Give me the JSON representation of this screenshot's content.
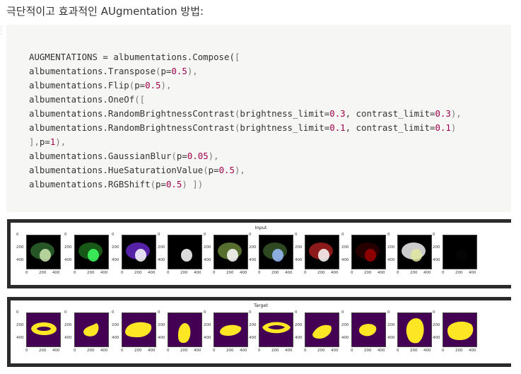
{
  "heading": "극단적이고 효과적인 AUgmentation 방법:",
  "code": {
    "lines": [
      [
        {
          "t": "AUGMENTATIONS = albumentations.Compose(",
          "c": ""
        },
        {
          "t": "[",
          "c": "p"
        }
      ],
      [
        {
          "t": "albumentations.Transpose",
          "c": ""
        },
        {
          "t": "(",
          "c": "p"
        },
        {
          "t": "p=",
          "c": ""
        },
        {
          "t": "0.5",
          "c": "n"
        },
        {
          "t": "),",
          "c": "p"
        }
      ],
      [
        {
          "t": "albumentations.Flip",
          "c": ""
        },
        {
          "t": "(",
          "c": "p"
        },
        {
          "t": "p=",
          "c": ""
        },
        {
          "t": "0.5",
          "c": "n"
        },
        {
          "t": "),",
          "c": "p"
        }
      ],
      [
        {
          "t": "albumentations.OneOf",
          "c": ""
        },
        {
          "t": "([",
          "c": "p"
        }
      ],
      [
        {
          "t": "albumentations.RandomBrightnessContrast",
          "c": ""
        },
        {
          "t": "(",
          "c": "p"
        },
        {
          "t": "brightness_limit=",
          "c": ""
        },
        {
          "t": "0.3",
          "c": "n"
        },
        {
          "t": ", contrast_limit=",
          "c": ""
        },
        {
          "t": "0.3",
          "c": "n"
        },
        {
          "t": "),",
          "c": "p"
        }
      ],
      [
        {
          "t": "albumentations.RandomBrightnessContrast",
          "c": ""
        },
        {
          "t": "(",
          "c": "p"
        },
        {
          "t": "brightness_limit=",
          "c": ""
        },
        {
          "t": "0.1",
          "c": "n"
        },
        {
          "t": ", contrast_limit=",
          "c": ""
        },
        {
          "t": "0.1",
          "c": "n"
        },
        {
          "t": ")",
          "c": "p"
        }
      ],
      [
        {
          "t": "],",
          "c": "p"
        },
        {
          "t": "p=",
          "c": ""
        },
        {
          "t": "1",
          "c": "n"
        },
        {
          "t": "),",
          "c": "p"
        }
      ],
      [
        {
          "t": "albumentations.GaussianBlur",
          "c": ""
        },
        {
          "t": "(",
          "c": "p"
        },
        {
          "t": "p=",
          "c": ""
        },
        {
          "t": "0.05",
          "c": "n"
        },
        {
          "t": "),",
          "c": "p"
        }
      ],
      [
        {
          "t": "albumentations.HueSaturationValue",
          "c": ""
        },
        {
          "t": "(",
          "c": "p"
        },
        {
          "t": "p=",
          "c": ""
        },
        {
          "t": "0.5",
          "c": "n"
        },
        {
          "t": "),",
          "c": "p"
        }
      ],
      [
        {
          "t": "albumentations.RGBShift",
          "c": ""
        },
        {
          "t": "(",
          "c": "p"
        },
        {
          "t": "p=",
          "c": ""
        },
        {
          "t": "0.5",
          "c": "n"
        },
        {
          "t": ") ])",
          "c": "p"
        }
      ]
    ]
  },
  "figures": {
    "input_title": "Input",
    "target_title": "Target",
    "y_ticks": [
      "0",
      "200",
      "400"
    ],
    "x_ticks": [
      "0",
      "200",
      "400"
    ],
    "tile_count": 10,
    "colors": {
      "target_bg": "#440154",
      "target_fg": "#fde725",
      "input_bg": "#000000"
    }
  }
}
